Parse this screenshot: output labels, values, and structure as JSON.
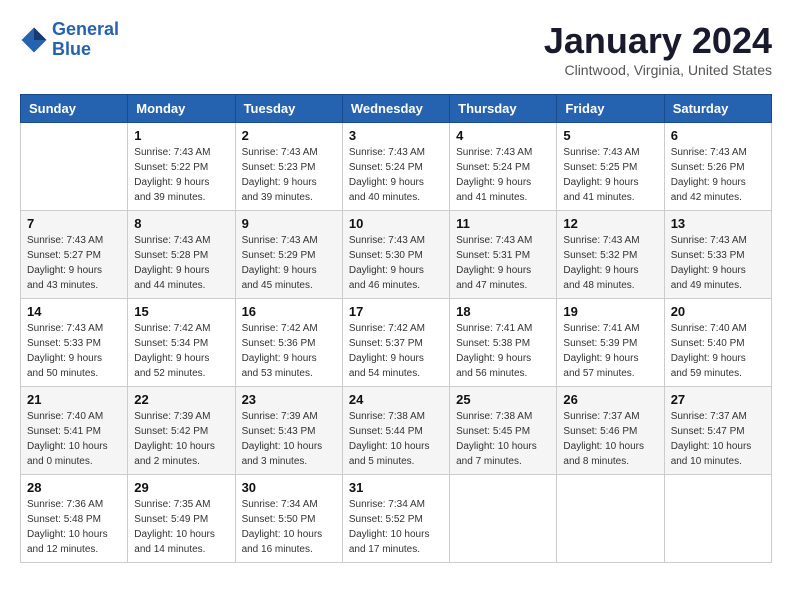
{
  "header": {
    "logo_line1": "General",
    "logo_line2": "Blue",
    "month": "January 2024",
    "location": "Clintwood, Virginia, United States"
  },
  "days_of_week": [
    "Sunday",
    "Monday",
    "Tuesday",
    "Wednesday",
    "Thursday",
    "Friday",
    "Saturday"
  ],
  "weeks": [
    [
      {
        "day": "",
        "sunrise": "",
        "sunset": "",
        "daylight": ""
      },
      {
        "day": "1",
        "sunrise": "Sunrise: 7:43 AM",
        "sunset": "Sunset: 5:22 PM",
        "daylight": "Daylight: 9 hours and 39 minutes."
      },
      {
        "day": "2",
        "sunrise": "Sunrise: 7:43 AM",
        "sunset": "Sunset: 5:23 PM",
        "daylight": "Daylight: 9 hours and 39 minutes."
      },
      {
        "day": "3",
        "sunrise": "Sunrise: 7:43 AM",
        "sunset": "Sunset: 5:24 PM",
        "daylight": "Daylight: 9 hours and 40 minutes."
      },
      {
        "day": "4",
        "sunrise": "Sunrise: 7:43 AM",
        "sunset": "Sunset: 5:24 PM",
        "daylight": "Daylight: 9 hours and 41 minutes."
      },
      {
        "day": "5",
        "sunrise": "Sunrise: 7:43 AM",
        "sunset": "Sunset: 5:25 PM",
        "daylight": "Daylight: 9 hours and 41 minutes."
      },
      {
        "day": "6",
        "sunrise": "Sunrise: 7:43 AM",
        "sunset": "Sunset: 5:26 PM",
        "daylight": "Daylight: 9 hours and 42 minutes."
      }
    ],
    [
      {
        "day": "7",
        "sunrise": "Sunrise: 7:43 AM",
        "sunset": "Sunset: 5:27 PM",
        "daylight": "Daylight: 9 hours and 43 minutes."
      },
      {
        "day": "8",
        "sunrise": "Sunrise: 7:43 AM",
        "sunset": "Sunset: 5:28 PM",
        "daylight": "Daylight: 9 hours and 44 minutes."
      },
      {
        "day": "9",
        "sunrise": "Sunrise: 7:43 AM",
        "sunset": "Sunset: 5:29 PM",
        "daylight": "Daylight: 9 hours and 45 minutes."
      },
      {
        "day": "10",
        "sunrise": "Sunrise: 7:43 AM",
        "sunset": "Sunset: 5:30 PM",
        "daylight": "Daylight: 9 hours and 46 minutes."
      },
      {
        "day": "11",
        "sunrise": "Sunrise: 7:43 AM",
        "sunset": "Sunset: 5:31 PM",
        "daylight": "Daylight: 9 hours and 47 minutes."
      },
      {
        "day": "12",
        "sunrise": "Sunrise: 7:43 AM",
        "sunset": "Sunset: 5:32 PM",
        "daylight": "Daylight: 9 hours and 48 minutes."
      },
      {
        "day": "13",
        "sunrise": "Sunrise: 7:43 AM",
        "sunset": "Sunset: 5:33 PM",
        "daylight": "Daylight: 9 hours and 49 minutes."
      }
    ],
    [
      {
        "day": "14",
        "sunrise": "Sunrise: 7:43 AM",
        "sunset": "Sunset: 5:33 PM",
        "daylight": "Daylight: 9 hours and 50 minutes."
      },
      {
        "day": "15",
        "sunrise": "Sunrise: 7:42 AM",
        "sunset": "Sunset: 5:34 PM",
        "daylight": "Daylight: 9 hours and 52 minutes."
      },
      {
        "day": "16",
        "sunrise": "Sunrise: 7:42 AM",
        "sunset": "Sunset: 5:36 PM",
        "daylight": "Daylight: 9 hours and 53 minutes."
      },
      {
        "day": "17",
        "sunrise": "Sunrise: 7:42 AM",
        "sunset": "Sunset: 5:37 PM",
        "daylight": "Daylight: 9 hours and 54 minutes."
      },
      {
        "day": "18",
        "sunrise": "Sunrise: 7:41 AM",
        "sunset": "Sunset: 5:38 PM",
        "daylight": "Daylight: 9 hours and 56 minutes."
      },
      {
        "day": "19",
        "sunrise": "Sunrise: 7:41 AM",
        "sunset": "Sunset: 5:39 PM",
        "daylight": "Daylight: 9 hours and 57 minutes."
      },
      {
        "day": "20",
        "sunrise": "Sunrise: 7:40 AM",
        "sunset": "Sunset: 5:40 PM",
        "daylight": "Daylight: 9 hours and 59 minutes."
      }
    ],
    [
      {
        "day": "21",
        "sunrise": "Sunrise: 7:40 AM",
        "sunset": "Sunset: 5:41 PM",
        "daylight": "Daylight: 10 hours and 0 minutes."
      },
      {
        "day": "22",
        "sunrise": "Sunrise: 7:39 AM",
        "sunset": "Sunset: 5:42 PM",
        "daylight": "Daylight: 10 hours and 2 minutes."
      },
      {
        "day": "23",
        "sunrise": "Sunrise: 7:39 AM",
        "sunset": "Sunset: 5:43 PM",
        "daylight": "Daylight: 10 hours and 3 minutes."
      },
      {
        "day": "24",
        "sunrise": "Sunrise: 7:38 AM",
        "sunset": "Sunset: 5:44 PM",
        "daylight": "Daylight: 10 hours and 5 minutes."
      },
      {
        "day": "25",
        "sunrise": "Sunrise: 7:38 AM",
        "sunset": "Sunset: 5:45 PM",
        "daylight": "Daylight: 10 hours and 7 minutes."
      },
      {
        "day": "26",
        "sunrise": "Sunrise: 7:37 AM",
        "sunset": "Sunset: 5:46 PM",
        "daylight": "Daylight: 10 hours and 8 minutes."
      },
      {
        "day": "27",
        "sunrise": "Sunrise: 7:37 AM",
        "sunset": "Sunset: 5:47 PM",
        "daylight": "Daylight: 10 hours and 10 minutes."
      }
    ],
    [
      {
        "day": "28",
        "sunrise": "Sunrise: 7:36 AM",
        "sunset": "Sunset: 5:48 PM",
        "daylight": "Daylight: 10 hours and 12 minutes."
      },
      {
        "day": "29",
        "sunrise": "Sunrise: 7:35 AM",
        "sunset": "Sunset: 5:49 PM",
        "daylight": "Daylight: 10 hours and 14 minutes."
      },
      {
        "day": "30",
        "sunrise": "Sunrise: 7:34 AM",
        "sunset": "Sunset: 5:50 PM",
        "daylight": "Daylight: 10 hours and 16 minutes."
      },
      {
        "day": "31",
        "sunrise": "Sunrise: 7:34 AM",
        "sunset": "Sunset: 5:52 PM",
        "daylight": "Daylight: 10 hours and 17 minutes."
      },
      {
        "day": "",
        "sunrise": "",
        "sunset": "",
        "daylight": ""
      },
      {
        "day": "",
        "sunrise": "",
        "sunset": "",
        "daylight": ""
      },
      {
        "day": "",
        "sunrise": "",
        "sunset": "",
        "daylight": ""
      }
    ]
  ]
}
